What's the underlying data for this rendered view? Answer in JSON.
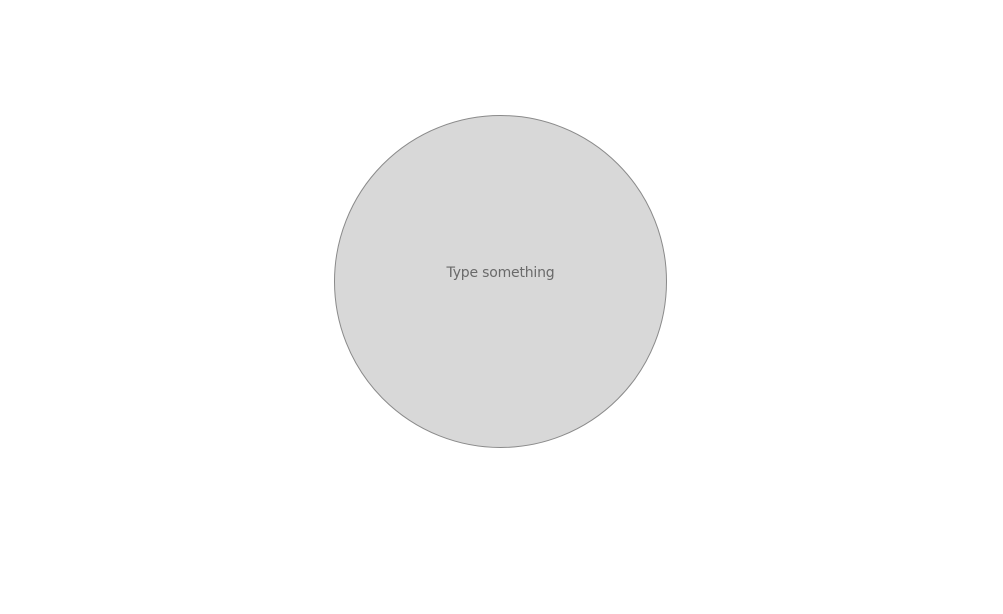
{
  "canvas": {
    "background_color": "#ffffff"
  },
  "shape": {
    "kind": "circle",
    "fill_color": "#d8d8d8",
    "border_color": "#8a8a8a",
    "placeholder": "Type something",
    "text_color": "#6a6a6a"
  }
}
